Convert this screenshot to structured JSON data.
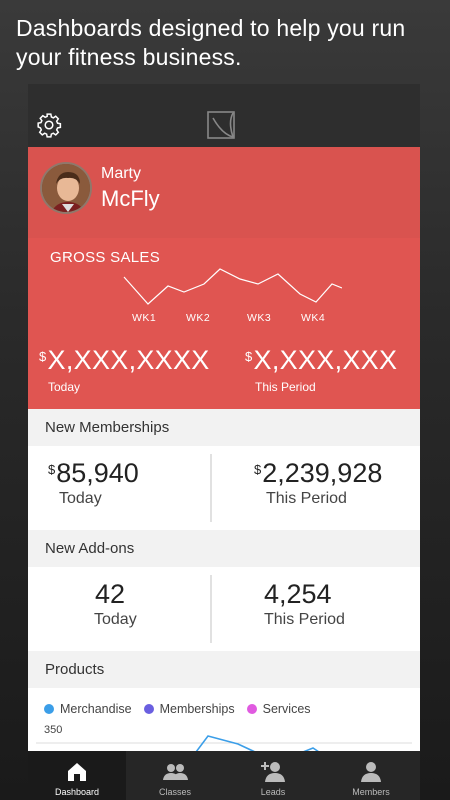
{
  "promo_text": "Dashboards designed to help you run your fitness business.",
  "profile": {
    "first_name": "Marty",
    "last_name": "McFly"
  },
  "gross_sales": {
    "title": "GROSS SALES",
    "weeks": [
      "WK1",
      "WK2",
      "WK3",
      "WK4"
    ],
    "today": {
      "value": "X,XXX,XXXX",
      "label": "Today",
      "currency": "$"
    },
    "period": {
      "value": "X,XXX,XXX",
      "label": "This Period",
      "currency": "$"
    }
  },
  "new_memberships": {
    "title": "New Memberships",
    "today": {
      "value": "85,940",
      "label": "Today",
      "currency": "$"
    },
    "period": {
      "value": "2,239,928",
      "label": "This Period",
      "currency": "$"
    }
  },
  "new_addons": {
    "title": "New Add-ons",
    "today": {
      "value": "42",
      "label": "Today"
    },
    "period": {
      "value": "4,254",
      "label": "This Period"
    }
  },
  "products": {
    "title": "Products",
    "legend": [
      {
        "label": "Merchandise",
        "color": "#3b9ee8"
      },
      {
        "label": "Memberships",
        "color": "#6a5fe0"
      },
      {
        "label": "Services",
        "color": "#e05ae0"
      }
    ],
    "y_tick": "350"
  },
  "tabs": [
    {
      "label": "Dashboard",
      "icon": "home-icon",
      "active": true
    },
    {
      "label": "Classes",
      "icon": "group-icon",
      "active": false
    },
    {
      "label": "Leads",
      "icon": "add-user-icon",
      "active": false
    },
    {
      "label": "Members",
      "icon": "user-icon",
      "active": false
    }
  ],
  "colors": {
    "accent_red": "#e05551",
    "profile_red": "#d9534f",
    "dark": "#2e2e2e"
  }
}
